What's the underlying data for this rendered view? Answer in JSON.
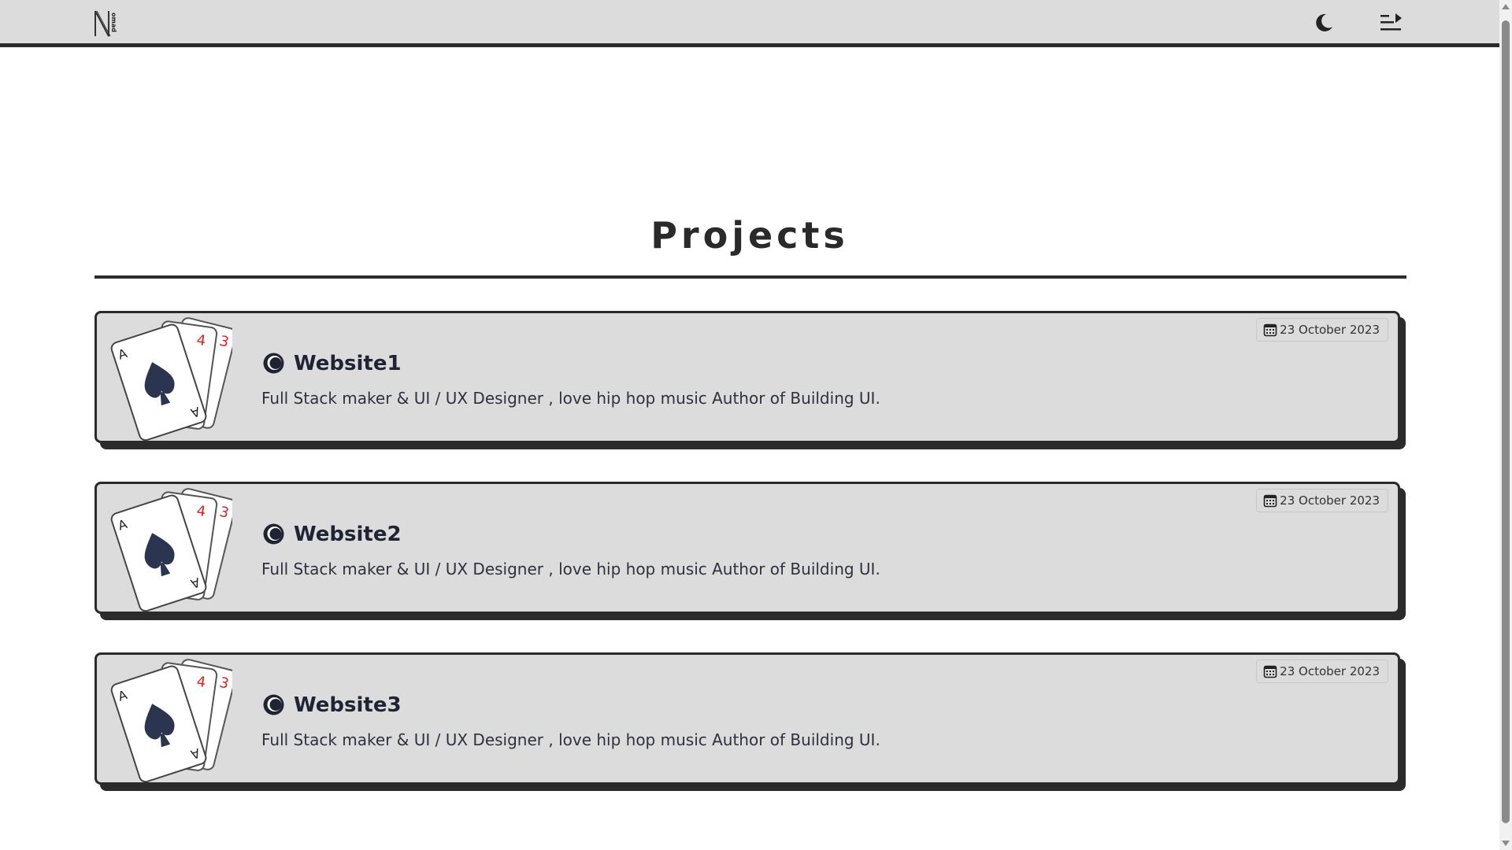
{
  "header": {
    "logo_text": "Nomad",
    "theme_icon": "moon-icon",
    "menu_icon": "menu-arrow-icon"
  },
  "main": {
    "title": "Projects"
  },
  "projects": [
    {
      "title": "Website1",
      "description": "Full Stack maker & UI / UX Designer , love hip hop music Author of Building UI.",
      "date": "23 October 2023",
      "image": "playing-cards-image",
      "icon": "globe-icon"
    },
    {
      "title": "Website2",
      "description": "Full Stack maker & UI / UX Designer , love hip hop music Author of Building UI.",
      "date": "23 October 2023",
      "image": "playing-cards-image",
      "icon": "globe-icon"
    },
    {
      "title": "Website3",
      "description": "Full Stack maker & UI / UX Designer , love hip hop music Author of Building UI.",
      "date": "23 October 2023",
      "image": "playing-cards-image",
      "icon": "globe-icon"
    }
  ],
  "colors": {
    "header_bg": "#dcdcdc",
    "card_bg": "#dcdcdc",
    "border_dark": "#2b2b2b",
    "title_text": "#2a2a2a"
  }
}
